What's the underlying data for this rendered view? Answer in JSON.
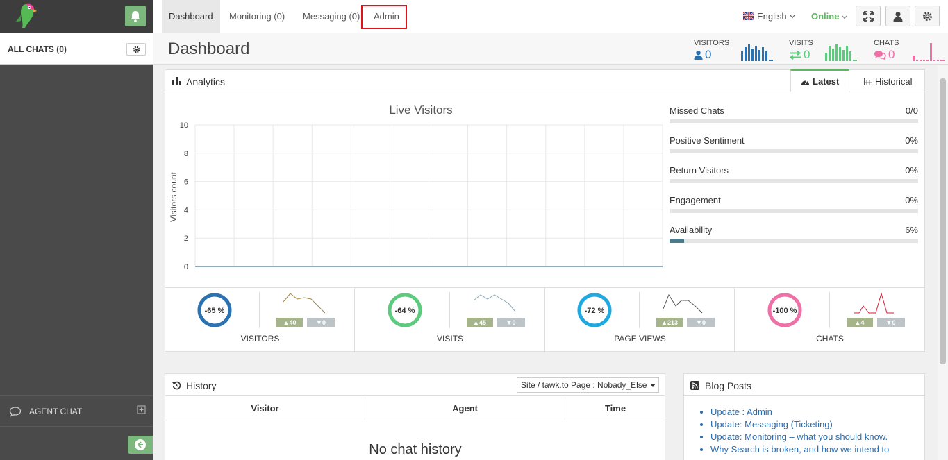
{
  "sidebar": {
    "all_chats": "ALL CHATS (0)",
    "agent_chat": "AGENT CHAT"
  },
  "nav": {
    "tabs": [
      "Dashboard",
      "Monitoring (0)",
      "Messaging (0)",
      "Admin"
    ],
    "language": "English",
    "status": "Online"
  },
  "header": {
    "title": "Dashboard",
    "visitors_label": "VISITORS",
    "visitors_value": "0",
    "visits_label": "VISITS",
    "visits_value": "0",
    "chats_label": "CHATS",
    "chats_value": "0"
  },
  "analytics": {
    "title": "Analytics",
    "tab_latest": "Latest",
    "tab_historical": "Historical",
    "chart_title": "Live Visitors",
    "ylabel": "Visitors count",
    "metrics": [
      {
        "label": "Missed Chats",
        "value": "0/0",
        "fraction": 0
      },
      {
        "label": "Positive Sentiment",
        "value": "0%",
        "fraction": 0
      },
      {
        "label": "Return Visitors",
        "value": "0%",
        "fraction": 0
      },
      {
        "label": "Engagement",
        "value": "0%",
        "fraction": 0
      },
      {
        "label": "Availability",
        "value": "6%",
        "fraction": 0.06
      }
    ],
    "kpis": [
      {
        "name": "VISITORS",
        "pct": "-65 %",
        "up": "40",
        "down": "0",
        "color": "#2b72b3"
      },
      {
        "name": "VISITS",
        "pct": "-64 %",
        "up": "45",
        "down": "0",
        "color": "#5ccb7e"
      },
      {
        "name": "PAGE VIEWS",
        "pct": "-72 %",
        "up": "213",
        "down": "0",
        "color": "#1ea9e1"
      },
      {
        "name": "CHATS",
        "pct": "-100 %",
        "up": "4",
        "down": "0",
        "color": "#ef6fa7"
      }
    ]
  },
  "chart_data": {
    "type": "line",
    "title": "Live Visitors",
    "ylabel": "Visitors count",
    "ylim": [
      0,
      10
    ],
    "yticks": [
      "0",
      "2",
      "4",
      "6",
      "8",
      "10"
    ],
    "series": [
      {
        "values": [
          0,
          0,
          0,
          0,
          0,
          0,
          0,
          0,
          0,
          0,
          0,
          0,
          0
        ]
      }
    ]
  },
  "history": {
    "title": "History",
    "filter": "Site / tawk.to Page : Nobady_Else",
    "columns": [
      "Visitor",
      "Agent",
      "Time"
    ],
    "empty": "No chat history"
  },
  "blog": {
    "title": "Blog Posts",
    "items": [
      "Update : Admin",
      "Update: Messaging (Ticketing)",
      "Update: Monitoring – what you should know.",
      "Why Search is broken, and how we intend to"
    ]
  }
}
